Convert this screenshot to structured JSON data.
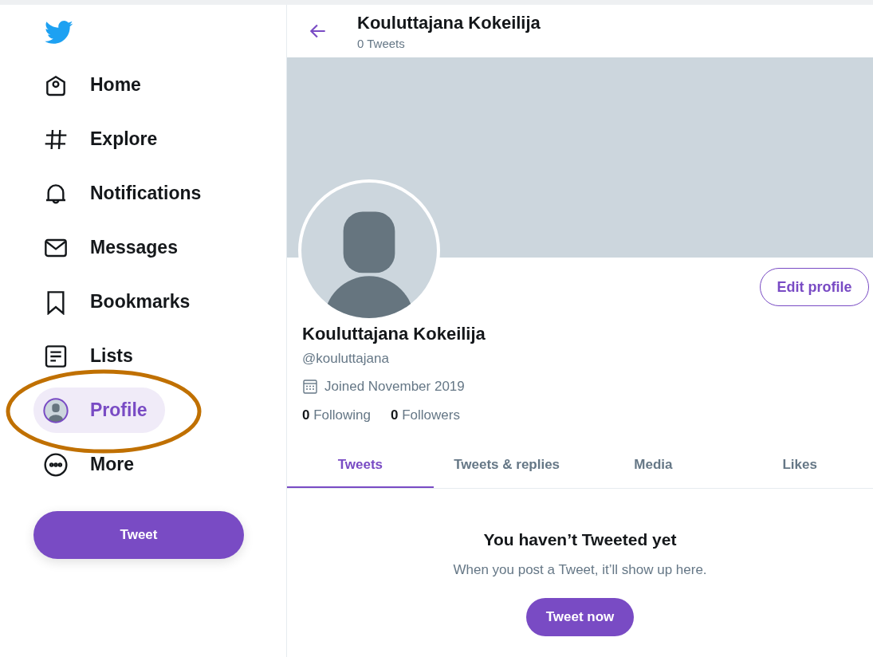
{
  "sidebar": {
    "items": [
      {
        "label": "Home",
        "kind": "home",
        "selected": false
      },
      {
        "label": "Explore",
        "kind": "hash",
        "selected": false
      },
      {
        "label": "Notifications",
        "kind": "bell",
        "selected": false
      },
      {
        "label": "Messages",
        "kind": "mail",
        "selected": false
      },
      {
        "label": "Bookmarks",
        "kind": "bookmark",
        "selected": false
      },
      {
        "label": "Lists",
        "kind": "list",
        "selected": false
      },
      {
        "label": "Profile",
        "kind": "avatar",
        "selected": true
      },
      {
        "label": "More",
        "kind": "more",
        "selected": false
      }
    ],
    "tweet_button": "Tweet"
  },
  "header": {
    "title": "Kouluttajana Kokeilija",
    "subtitle": "0 Tweets"
  },
  "profile": {
    "edit_button": "Edit profile",
    "name": "Kouluttajana Kokeilija",
    "handle": "@kouluttajana",
    "joined": "Joined November 2019",
    "following_count": "0",
    "following_label": "Following",
    "followers_count": "0",
    "followers_label": "Followers"
  },
  "tabs": [
    {
      "label": "Tweets",
      "selected": true
    },
    {
      "label": "Tweets & replies",
      "selected": false
    },
    {
      "label": "Media",
      "selected": false
    },
    {
      "label": "Likes",
      "selected": false
    }
  ],
  "empty_state": {
    "title": "You haven’t Tweeted yet",
    "text": "When you post a Tweet, it’ll show up here.",
    "button": "Tweet now"
  }
}
